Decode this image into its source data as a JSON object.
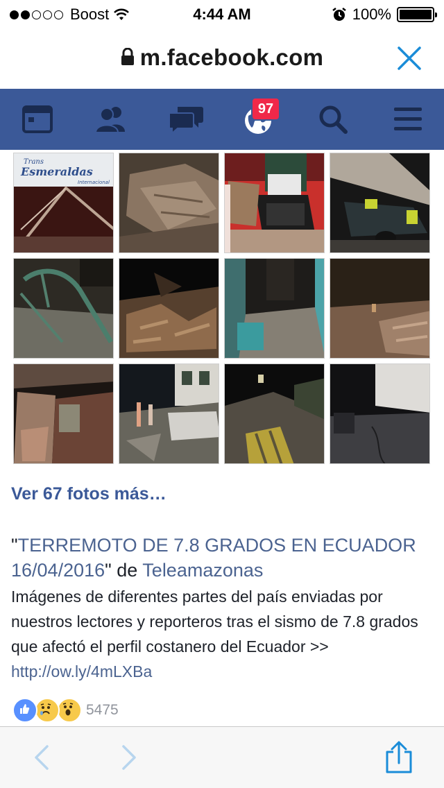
{
  "status_bar": {
    "carrier": "Boost",
    "time": "4:44 AM",
    "battery": "100%",
    "signal_bars_filled": 2,
    "signal_bars_total": 5
  },
  "browser": {
    "url": "m.facebook.com"
  },
  "fb_nav": {
    "notification_count": "97",
    "items": [
      "news-feed",
      "friends",
      "messages",
      "notifications",
      "search",
      "menu"
    ]
  },
  "post": {
    "more_photos_label": "Ver 67 fotos más…",
    "quote_open": "\"",
    "album_title": "TERREMOTO DE 7.8 GRADOS EN ECUADOR 16/04/2016",
    "quote_close": "\"",
    "by_word": " de ",
    "page_name": "Teleamazonas",
    "description": "Imágenes de diferentes partes del país enviadas por nuestros lectores y reporteros tras el sismo de 7.8 grados que afectó el perfil costanero del Ecuador >> ",
    "link": "http://ow.ly/4mLXBa",
    "reaction_count": "5475",
    "reactions": [
      "like",
      "sad",
      "wow"
    ]
  },
  "photo_sign_text": [
    "Trans",
    "Esmeraldas",
    "Internacional"
  ],
  "colors": {
    "facebook_blue": "#3b5998",
    "ios_blue": "#1a8cd8",
    "badge_red": "#f02849",
    "link_blue": "#4b6390"
  }
}
